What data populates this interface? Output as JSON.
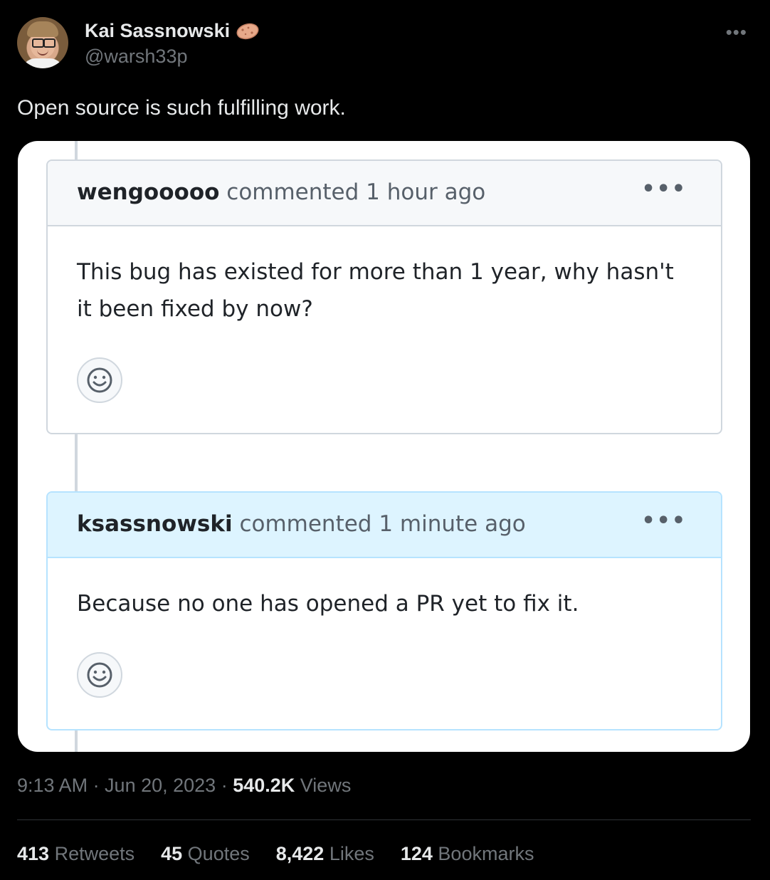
{
  "tweet": {
    "author": {
      "display_name": "Kai Sassnowski",
      "name_emoji": "potato-icon",
      "handle": "@warsh33p"
    },
    "more_icon": "more-icon",
    "text": "Open source is such fulfilling work.",
    "timestamp": "9:13 AM · Jun 20, 2023",
    "separator": " · ",
    "views_count": "540.2K",
    "views_label": " Views"
  },
  "screenshot": {
    "comments": [
      {
        "author": "wengooooo",
        "action": " commented 1 hour ago",
        "body": "This bug has existed for more than 1 year, why hasn't it been fixed by now?",
        "reaction_icon": "smiley-icon"
      },
      {
        "author": "ksassnowski",
        "action": " commented 1 minute ago",
        "body": "Because no one has opened a PR yet to fix it.",
        "reaction_icon": "smiley-icon"
      }
    ]
  },
  "stats": {
    "retweets": {
      "count": "413",
      "label": " Retweets"
    },
    "quotes": {
      "count": "45",
      "label": " Quotes"
    },
    "likes": {
      "count": "8,422",
      "label": " Likes"
    },
    "bookmarks": {
      "count": "124",
      "label": " Bookmarks"
    }
  },
  "colors": {
    "background": "#000000",
    "text_primary": "#e7e9ea",
    "text_secondary": "#71767b",
    "comment_header_default": "#f6f8fa",
    "comment_header_author": "#ddf4ff"
  }
}
